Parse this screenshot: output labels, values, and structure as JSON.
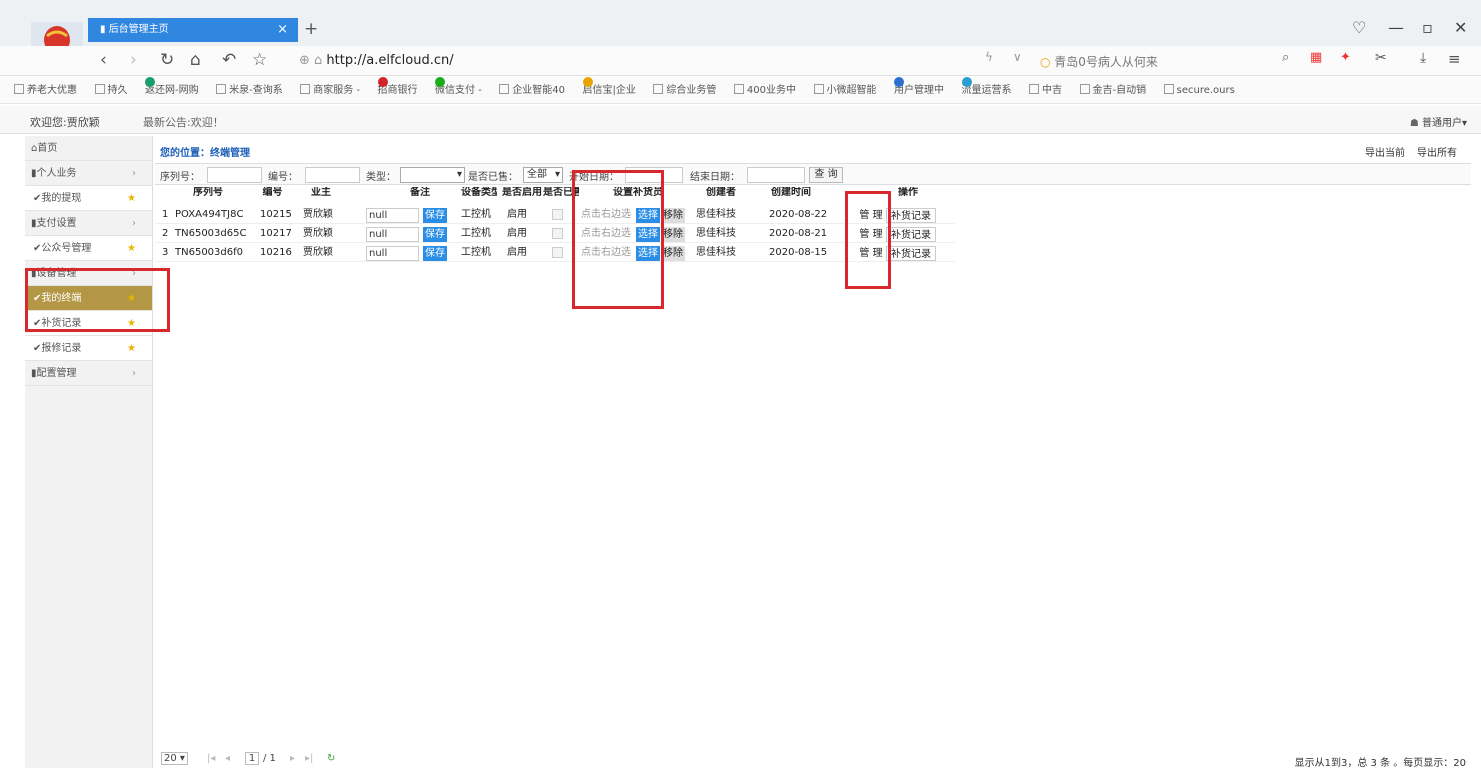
{
  "browser": {
    "tab_title": "后台管理主页",
    "tab_close": "×",
    "new_tab": "+",
    "url": "http://a.elfcloud.cn/",
    "search_text": "青岛0号病人从何来",
    "bookmarks": [
      "养老大优惠",
      "持久",
      "返还网-网购",
      "米泉-查询系",
      "商家服务 -",
      "招商银行",
      "微信支付 -",
      "企业智能40",
      "启信宝|企业",
      "综合业务管",
      "400业务中",
      "小微超智能",
      "用户管理中",
      "流量运营系",
      "中吉",
      "金吉-自动销",
      "secure.ours"
    ]
  },
  "app": {
    "welcome": "欢迎您:贾欣颖",
    "notice": "最新公告:欢迎！",
    "user_menu": "普通用户▾"
  },
  "sidebar": {
    "items": [
      {
        "label": "首页",
        "type": "top"
      },
      {
        "label": "个人业务",
        "type": "group"
      },
      {
        "label": "✔我的提现",
        "type": "sub"
      },
      {
        "label": "支付设置",
        "type": "group"
      },
      {
        "label": "✔公众号管理",
        "type": "sub"
      },
      {
        "label": "设备管理",
        "type": "group"
      },
      {
        "label": "✔我的终端",
        "type": "sub"
      },
      {
        "label": "✔补货记录",
        "type": "sub"
      },
      {
        "label": "✔报修记录",
        "type": "sub"
      },
      {
        "label": "配置管理",
        "type": "group"
      }
    ]
  },
  "main": {
    "breadcrumb": "您的位置：终端管理",
    "export_current": "导出当前",
    "export_all": "导出所有",
    "filters": {
      "serial_label": "序列号：",
      "number_label": "编号：",
      "type_label": "类型：",
      "sold_label": "是否已售：",
      "sold_value": "全部",
      "start_label": "开始日期：",
      "end_label": "结束日期：",
      "query_button": "查 询"
    },
    "columns": [
      "序列号",
      "编号",
      "业主",
      "备注",
      "设备类型",
      "是否启用",
      "是否已售",
      "设置补货员",
      "创建者",
      "创建时间",
      "操作"
    ],
    "rows": [
      {
        "idx": "1",
        "serial": "POXA494TJ8C",
        "number": "10215",
        "owner": "贾欣颖",
        "remark": "null",
        "save": "保存",
        "device_type": "工控机",
        "enabled": "启用",
        "hint": "点击右边选",
        "select": "选择",
        "remove": "移除",
        "creator": "思佳科技",
        "created": "2020-08-22",
        "manage": "管 理",
        "restock": "补货记录"
      },
      {
        "idx": "2",
        "serial": "TN65003d65C",
        "number": "10217",
        "owner": "贾欣颖",
        "remark": "null",
        "save": "保存",
        "device_type": "工控机",
        "enabled": "启用",
        "hint": "点击右边选",
        "select": "选择",
        "remove": "移除",
        "creator": "思佳科技",
        "created": "2020-08-21",
        "manage": "管 理",
        "restock": "补货记录"
      },
      {
        "idx": "3",
        "serial": "TN65003d6f0",
        "number": "10216",
        "owner": "贾欣颖",
        "remark": "null",
        "save": "保存",
        "device_type": "工控机",
        "enabled": "启用",
        "hint": "点击右边选",
        "select": "选择",
        "remove": "移除",
        "creator": "思佳科技",
        "created": "2020-08-15",
        "manage": "管 理",
        "restock": "补货记录"
      }
    ],
    "pager": {
      "page_size": "20",
      "page": "1",
      "total_pages": "/ 1",
      "info": "显示从1到3，总 3 条 。每页显示：20"
    }
  },
  "colors": {
    "tab": "#2f87e0",
    "active_sidebar": "#b39745",
    "highlight_box": "#d9282c",
    "button": "#2a8de6"
  }
}
